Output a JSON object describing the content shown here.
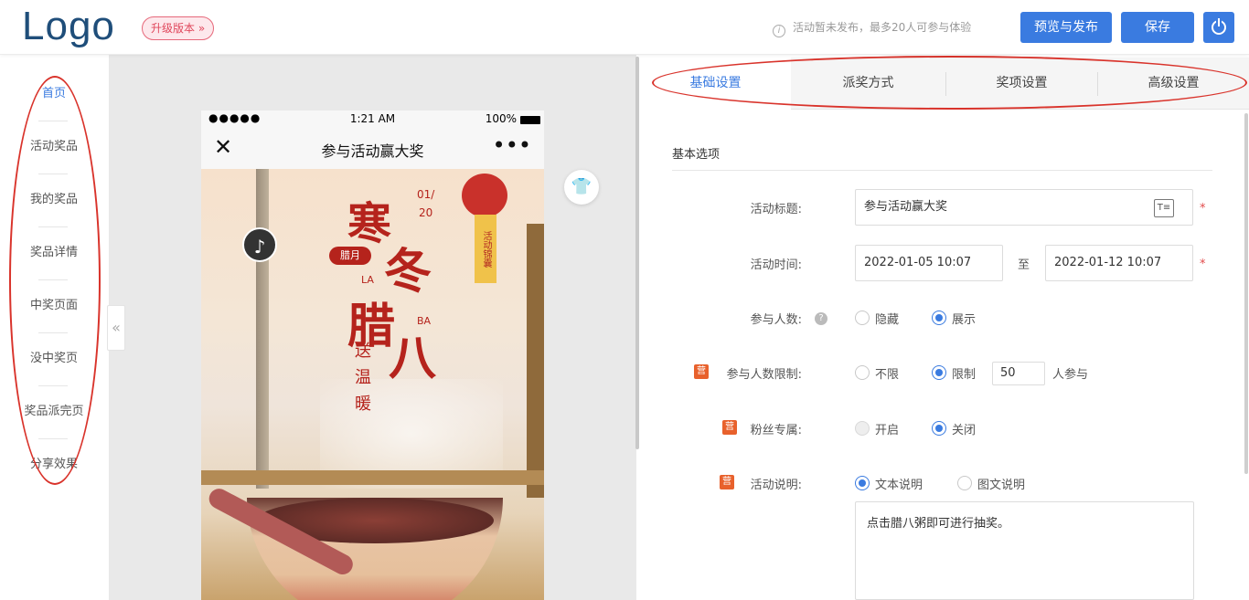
{
  "header": {
    "logo": "Logo",
    "upgrade_label": "升级版本 »",
    "notice": "活动暂未发布，最多20人可参与体验",
    "publish_label": "预览与发布",
    "save_label": "保存"
  },
  "sidebar": {
    "items": [
      {
        "label": "首页",
        "active": true
      },
      {
        "label": "活动奖品"
      },
      {
        "label": "我的奖品"
      },
      {
        "label": "奖品详情"
      },
      {
        "label": "中奖页面"
      },
      {
        "label": "没中奖页"
      },
      {
        "label": "奖品派完页"
      },
      {
        "label": "分享效果"
      }
    ],
    "collapse_glyph": "«"
  },
  "phone": {
    "status_dots": "●●●●●",
    "status_time": "1:21 AM",
    "status_battery": "100%",
    "nav_close": "✕",
    "nav_title": "参与活动赢大奖",
    "nav_more": "•••",
    "poster": {
      "han": "寒",
      "dong": "冬",
      "la": "腊",
      "ba": "八",
      "date_month": "01/",
      "date_day": "20",
      "month_badge": "腊月",
      "la_en": "LA",
      "ba_en": "BA",
      "song_wen_nuan": "送温暖",
      "lantern_text": "活动锦囊",
      "music_glyph": "♪"
    }
  },
  "tabs": [
    {
      "label": "基础设置",
      "active": true
    },
    {
      "label": "派奖方式"
    },
    {
      "label": "奖项设置"
    },
    {
      "label": "高级设置"
    }
  ],
  "form": {
    "section_title": "基本选项",
    "title_label": "活动标题:",
    "title_value": "参与活动赢大奖",
    "time_label": "活动时间:",
    "start_time": "2022-01-05 10:07",
    "to_label": "至",
    "end_time": "2022-01-12 10:07",
    "participants_label": "参与人数:",
    "participants_options": [
      "隐藏",
      "展示"
    ],
    "participants_selected": "展示",
    "limit_label": "参与人数限制:",
    "limit_options": [
      "不限",
      "限制"
    ],
    "limit_selected": "限制",
    "limit_value": "50",
    "limit_suffix": "人参与",
    "fans_label": "粉丝专属:",
    "fans_options": [
      "开启",
      "关闭"
    ],
    "fans_selected": "关闭",
    "desc_label": "活动说明:",
    "desc_options": [
      "文本说明",
      "图文说明"
    ],
    "desc_selected": "文本说明",
    "desc_text": "点击腊八粥即可进行抽奖。",
    "ying_badge": "营",
    "required_mark": "*"
  },
  "colors": {
    "accent": "#3a7be0",
    "annotation_red": "#d9332b",
    "logo": "#1f4e7a",
    "badge_orange": "#e8612c"
  }
}
